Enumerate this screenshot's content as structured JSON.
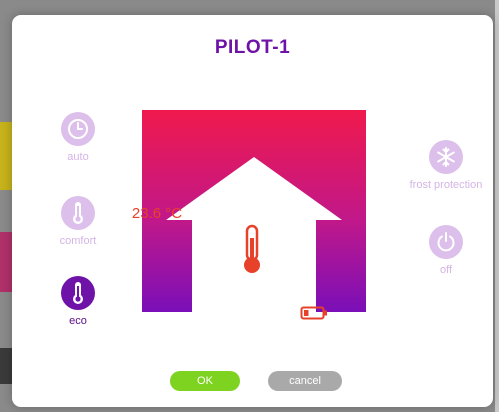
{
  "dialog": {
    "title": "PILOT-1",
    "temperature": "23.6 °C",
    "ok_label": "OK",
    "cancel_label": "cancel"
  },
  "modes": {
    "auto": {
      "label": "auto",
      "icon": "clock-icon",
      "active": false
    },
    "comfort": {
      "label": "comfort",
      "icon": "thermometer-icon",
      "active": false
    },
    "eco": {
      "label": "eco",
      "icon": "thermometer-icon",
      "active": true
    },
    "frost": {
      "label": "frost protection",
      "icon": "snowflake-icon",
      "active": false
    },
    "off": {
      "label": "off",
      "icon": "power-icon",
      "active": false
    }
  },
  "battery": {
    "level": 0.25,
    "color": "#e8412a"
  },
  "colors": {
    "accent": "#6f12a8",
    "inactive": "#dcbfea",
    "ok": "#7ed321",
    "cancel": "#a9a9a9",
    "gradient_top": "#f0194d",
    "gradient_bottom": "#7a0fb8",
    "temperature": "#e8412a"
  }
}
